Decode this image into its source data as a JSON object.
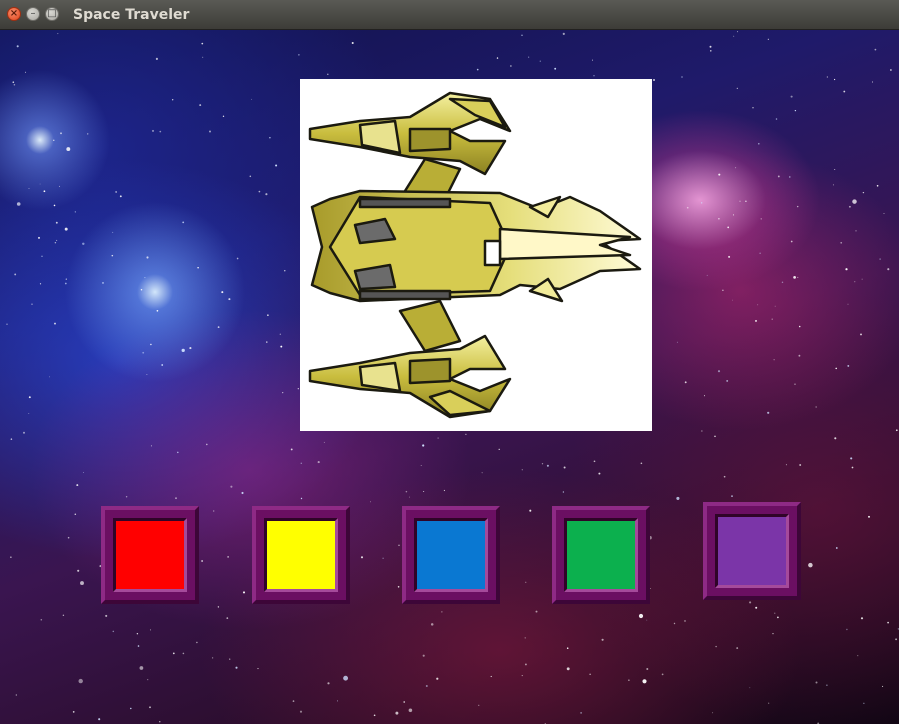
{
  "window": {
    "title": "Space Traveler"
  },
  "icons": {
    "close": "close-icon",
    "minimize": "minimize-icon",
    "maximize": "maximize-icon",
    "ship": "spaceship-icon"
  },
  "palette": {
    "buttons": [
      {
        "id": "red",
        "color": "#ff0000"
      },
      {
        "id": "yellow",
        "color": "#ffff00"
      },
      {
        "id": "blue",
        "color": "#0a78d2"
      },
      {
        "id": "green",
        "color": "#0cb04e"
      },
      {
        "id": "purple",
        "color": "#7b35a8"
      }
    ]
  }
}
